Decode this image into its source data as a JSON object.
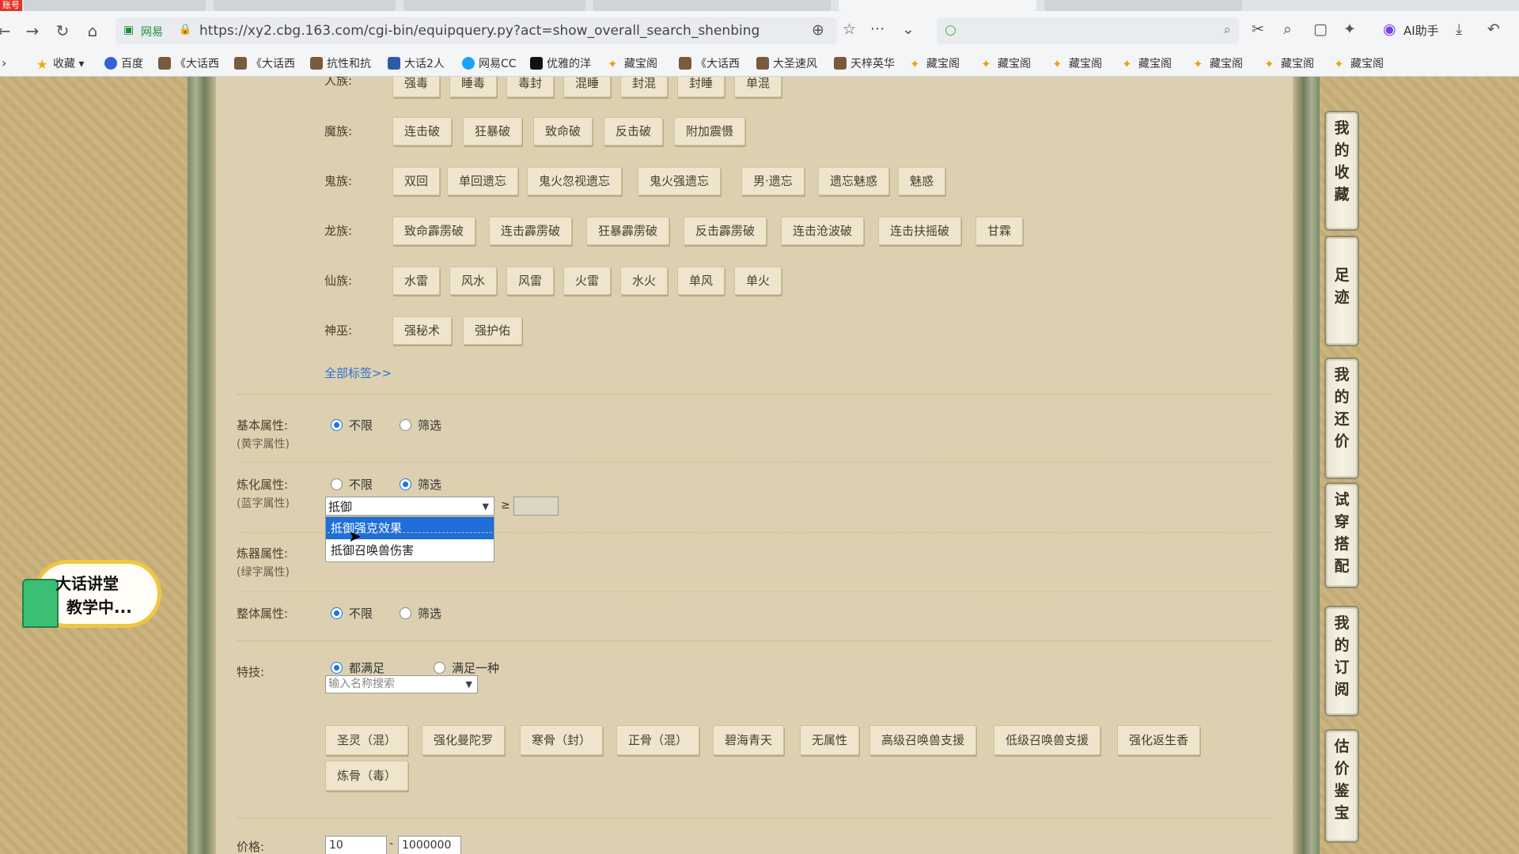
{
  "browser": {
    "tab_badge": "账号",
    "url": "https://xy2.cbg.163.com/cgi-bin/equipquery.py?act=show_overall_search_shenbing",
    "site_name": "网易",
    "ai_label": "AI助手",
    "bookmarks": [
      "收藏",
      "百度",
      "《大话西",
      "《大话西",
      "抗性和抗",
      "大话2人",
      "网易CC",
      "优雅的洋",
      "藏宝阁",
      "《大话西",
      "大圣速风",
      "天梓英华",
      "藏宝阁",
      "藏宝阁",
      "藏宝阁",
      "藏宝阁",
      "藏宝阁",
      "藏宝阁",
      "藏宝阁"
    ]
  },
  "tags": {
    "renzu": {
      "label": "人族:",
      "items": [
        "强毒",
        "睡毒",
        "毒封",
        "混睡",
        "封混",
        "封睡",
        "单混"
      ]
    },
    "mozu": {
      "label": "魔族:",
      "items": [
        "连击破",
        "狂暴破",
        "致命破",
        "反击破",
        "附加震慑"
      ]
    },
    "guizu": {
      "label": "鬼族:",
      "items": [
        "双回",
        "单回遗忘",
        "鬼火忽视遗忘",
        "鬼火强遗忘",
        "男·遗忘",
        "遗忘魅惑",
        "魅惑"
      ]
    },
    "longzu": {
      "label": "龙族:",
      "items": [
        "致命霹雳破",
        "连击霹雳破",
        "狂暴霹雳破",
        "反击霹雳破",
        "连击沧波破",
        "连击扶摇破",
        "甘霖"
      ]
    },
    "xianzu": {
      "label": "仙族:",
      "items": [
        "水雷",
        "风水",
        "风雷",
        "火雷",
        "水火",
        "单风",
        "单火"
      ]
    },
    "shenwu": {
      "label": "神巫:",
      "items": [
        "强秘术",
        "强护佑"
      ]
    },
    "all_link": "全部标签>>"
  },
  "filters": {
    "basic": {
      "label": "基本属性:",
      "sub": "(黄字属性)",
      "opt1": "不限",
      "opt2": "筛选"
    },
    "lianhua": {
      "label": "炼化属性:",
      "sub": "(蓝字属性)",
      "opt1": "不限",
      "opt2": "筛选",
      "select_value": "抵御",
      "gte": "≥"
    },
    "dropdown": {
      "items": [
        "抵御强克效果",
        "抵御召唤兽伤害"
      ]
    },
    "lianqi": {
      "label": "炼器属性:",
      "sub": "(绿字属性)"
    },
    "overall": {
      "label": "整体属性:",
      "opt1": "不限",
      "opt2": "筛选"
    },
    "skill": {
      "label": "特技:",
      "opt1": "都满足",
      "opt2": "满足一种",
      "search_placeholder": "输入名称搜索",
      "items": [
        "圣灵（混）",
        "强化曼陀罗",
        "寒骨（封）",
        "正骨（混）",
        "碧海青天",
        "无属性",
        "高级召唤兽支援",
        "低级召唤兽支援",
        "强化返生香",
        "炼骨（毒）"
      ]
    },
    "price": {
      "label": "价格:",
      "min": "10",
      "sep": "-",
      "max": "1000000"
    }
  },
  "side_panel": [
    "我的收藏",
    "足迹",
    "我的还价",
    "试穿搭配",
    "我的订阅",
    "估价鉴宝"
  ],
  "badge": {
    "line1": "大话讲堂",
    "line2": "教学中..."
  }
}
